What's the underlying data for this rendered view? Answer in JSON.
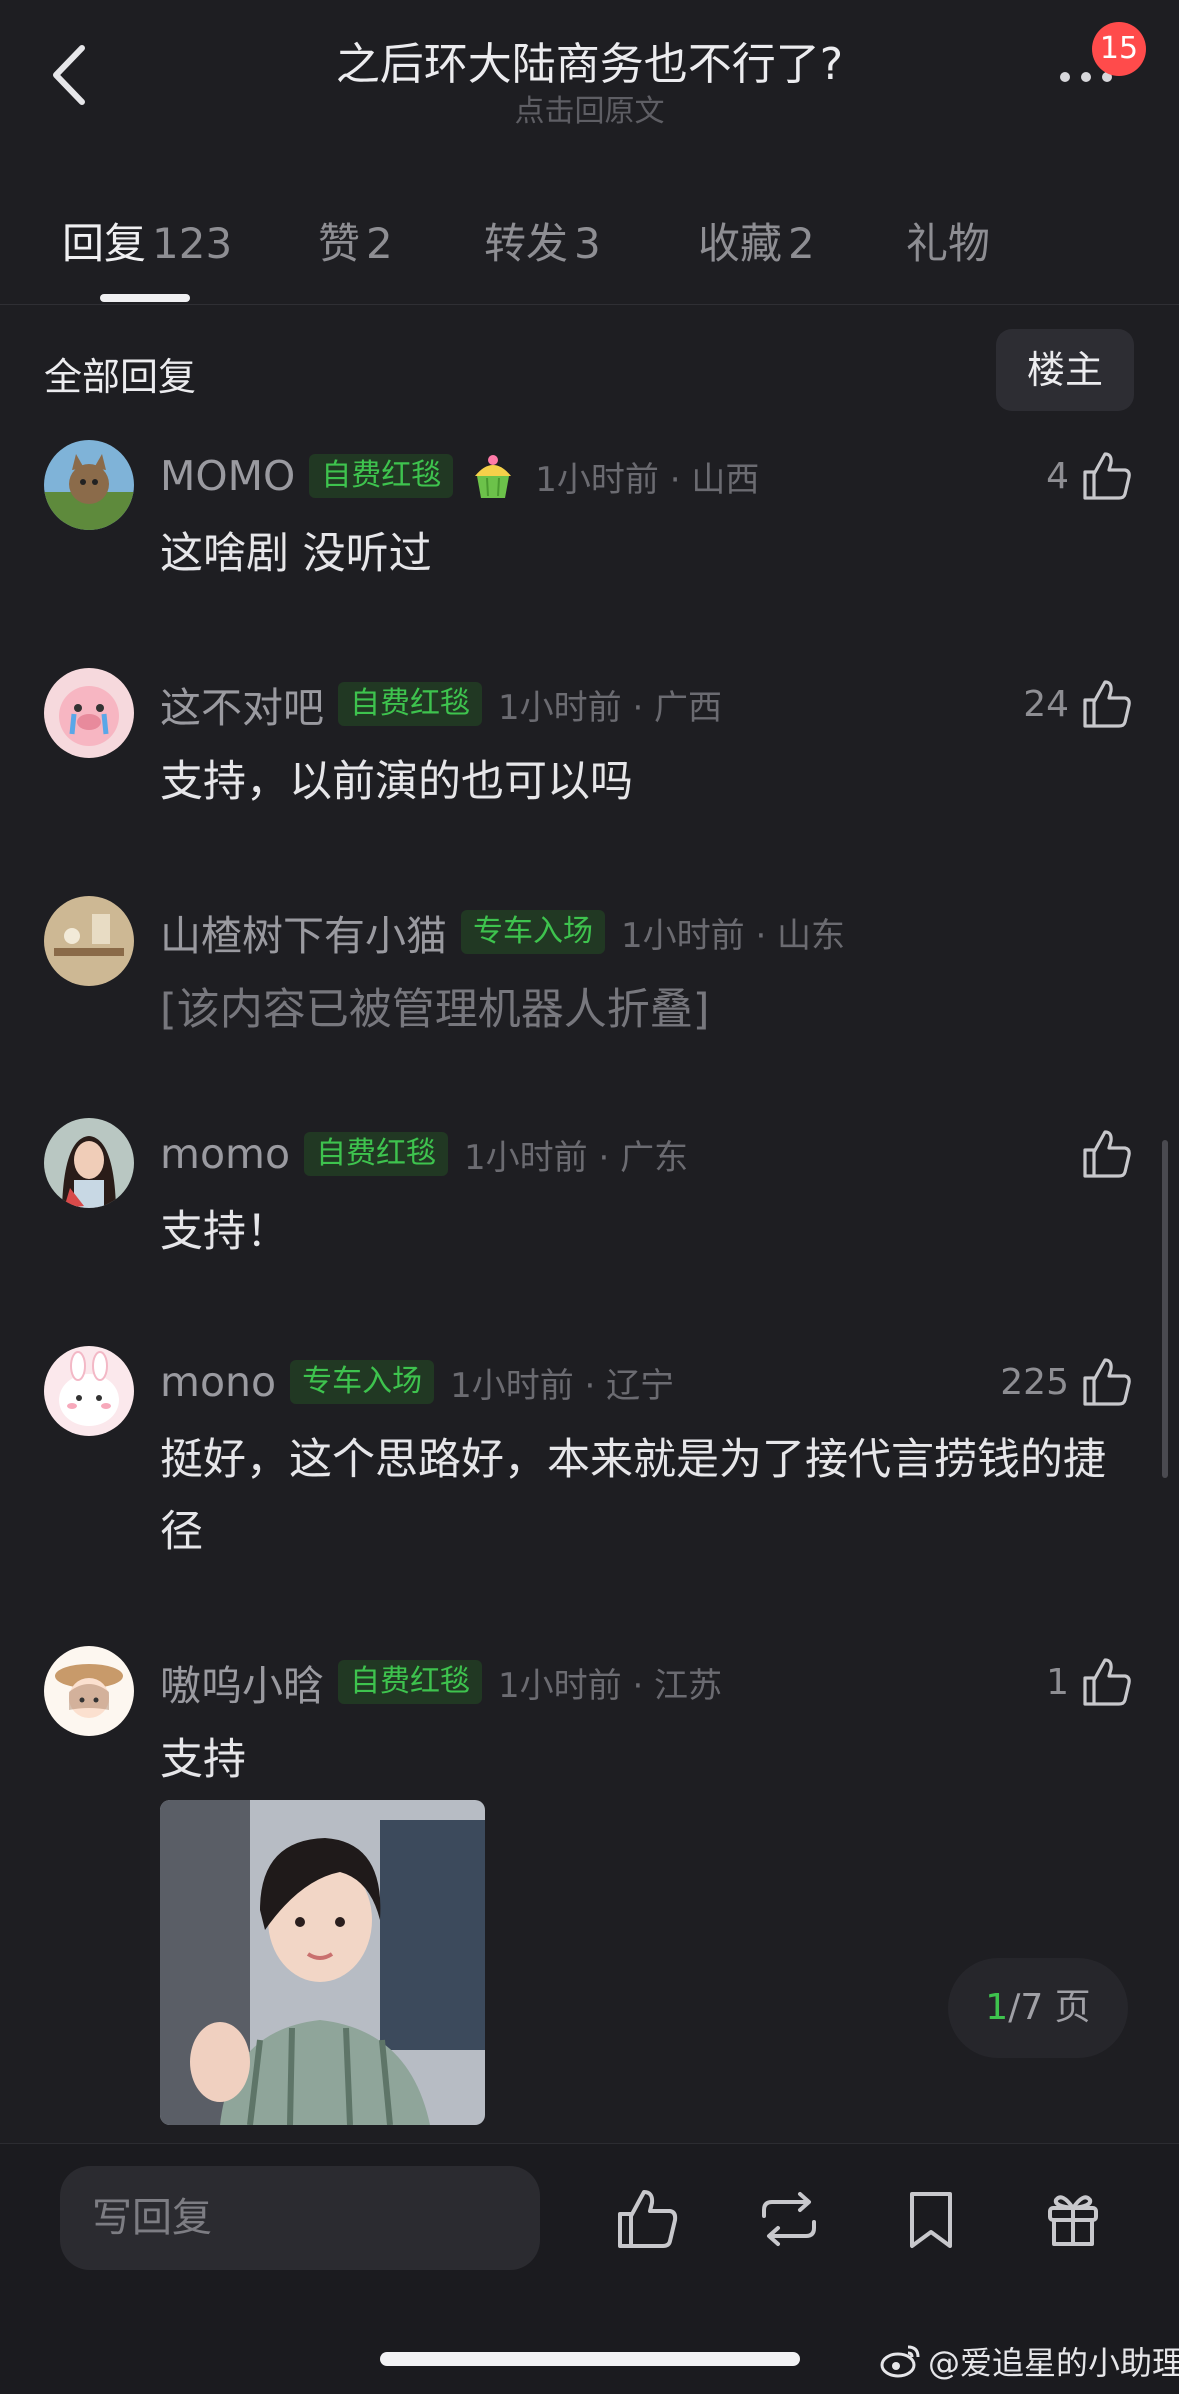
{
  "header": {
    "title": "之后环大陆商务也不行了?",
    "subtitle": "点击回原文",
    "badge_count": "15"
  },
  "tabs": [
    {
      "label": "回复",
      "count": "123",
      "active": true
    },
    {
      "label": "赞",
      "count": "2"
    },
    {
      "label": "转发",
      "count": "3"
    },
    {
      "label": "收藏",
      "count": "2"
    },
    {
      "label": "礼物",
      "count": ""
    }
  ],
  "section": {
    "title": "全部回复",
    "filter_button": "楼主"
  },
  "comments": [
    {
      "username": "MOMO",
      "tag": "自费红毯",
      "time": "1小时前 · 山西",
      "likes": "4",
      "text": "这啥剧 没听过",
      "avatar": "cat-avatar",
      "has_cake": true
    },
    {
      "username": "这不对吧",
      "tag": "自费红毯",
      "time": "1小时前 · 广西",
      "likes": "24",
      "text": "支持，以前演的也可以吗",
      "avatar": "pig-avatar"
    },
    {
      "username": "山楂树下有小猫",
      "tag": "专车入场",
      "time": "1小时前 · 山东",
      "likes": "",
      "text": "[该内容已被管理机器人折叠]",
      "avatar": "room-avatar",
      "folded": true
    },
    {
      "username": "momo",
      "tag": "自费红毯",
      "time": "1小时前 · 广东",
      "likes": "",
      "text": "支持！",
      "avatar": "girl-avatar"
    },
    {
      "username": "mono",
      "tag": "专车入场",
      "time": "1小时前 · 辽宁",
      "likes": "225",
      "text": "挺好，这个思路好，本来就是为了接代言捞钱的捷径",
      "avatar": "bunny-avatar"
    },
    {
      "username": "嗷呜小晗",
      "tag": "自费红毯",
      "time": "1小时前 · 江苏",
      "likes": "1",
      "text": "支持",
      "avatar": "hat-girl-avatar",
      "has_photo": true
    }
  ],
  "pager": {
    "current": "1",
    "rest": "/7 页"
  },
  "bottom": {
    "reply_placeholder": "写回复"
  },
  "watermark": "@爱追星的小助理",
  "colors": {
    "background": "#1e1e22",
    "tag_green": "#3ec34e",
    "badge_red": "#ff4b4b"
  }
}
